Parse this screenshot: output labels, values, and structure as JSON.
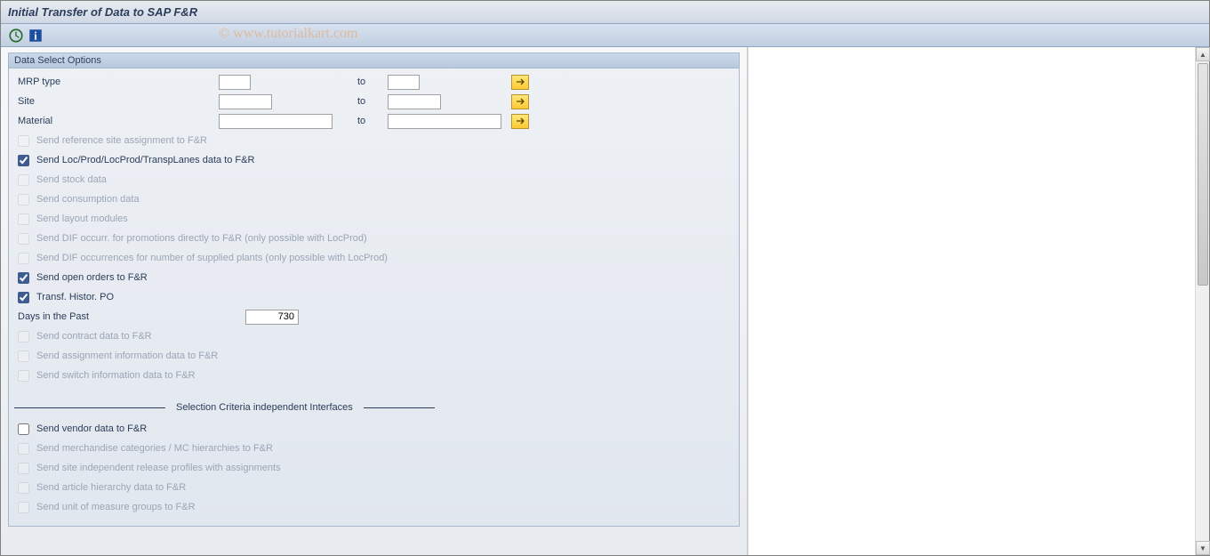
{
  "window": {
    "title": "Initial Transfer of Data to SAP F&R"
  },
  "watermark": "© www.tutorialkart.com",
  "group": {
    "title": "Data Select Options"
  },
  "fields": {
    "mrp_type": {
      "label": "MRP type",
      "from": "",
      "to_label": "to",
      "to": ""
    },
    "site": {
      "label": "Site",
      "from": "",
      "to_label": "to",
      "to": ""
    },
    "material": {
      "label": "Material",
      "from": "",
      "to_label": "to",
      "to": ""
    },
    "days_past": {
      "label": "Days in the Past",
      "value": "730"
    }
  },
  "checkboxes": [
    {
      "id": "chk_ref_site",
      "label": "Send reference site assignment to F&R",
      "checked": false,
      "enabled": false
    },
    {
      "id": "chk_locprod",
      "label": "Send Loc/Prod/LocProd/TranspLanes data to F&R",
      "checked": true,
      "enabled": true
    },
    {
      "id": "chk_stock",
      "label": "Send stock data",
      "checked": false,
      "enabled": false
    },
    {
      "id": "chk_consump",
      "label": "Send consumption data",
      "checked": false,
      "enabled": false
    },
    {
      "id": "chk_layout",
      "label": "Send layout modules",
      "checked": false,
      "enabled": false
    },
    {
      "id": "chk_dif_promo",
      "label": "Send DIF occurr. for promotions directly to F&R (only possible with LocProd)",
      "checked": false,
      "enabled": false
    },
    {
      "id": "chk_dif_supply",
      "label": "Send DIF occurrences for number of supplied plants (only possible with LocProd)",
      "checked": false,
      "enabled": false
    },
    {
      "id": "chk_openord",
      "label": "Send open orders to F&R",
      "checked": true,
      "enabled": true
    },
    {
      "id": "chk_histpo",
      "label": "Transf. Histor. PO",
      "checked": true,
      "enabled": true
    }
  ],
  "checkboxes2": [
    {
      "id": "chk_contract",
      "label": "Send contract data to F&R",
      "checked": false,
      "enabled": false
    },
    {
      "id": "chk_assign",
      "label": "Send assignment information data to F&R",
      "checked": false,
      "enabled": false
    },
    {
      "id": "chk_switch",
      "label": "Send switch information data to F&R",
      "checked": false,
      "enabled": false
    }
  ],
  "section2_title": "Selection Criteria independent Interfaces",
  "checkboxes3": [
    {
      "id": "chk_vendor",
      "label": "Send vendor data to F&R",
      "checked": false,
      "enabled": true
    },
    {
      "id": "chk_merch",
      "label": "Send merchandise categories / MC hierarchies to F&R",
      "checked": false,
      "enabled": false
    },
    {
      "id": "chk_siterel",
      "label": "Send site independent release profiles with assignments",
      "checked": false,
      "enabled": false
    },
    {
      "id": "chk_arthier",
      "label": "Send article hierarchy data to F&R",
      "checked": false,
      "enabled": false
    },
    {
      "id": "chk_uom",
      "label": "Send unit of measure groups to F&R",
      "checked": false,
      "enabled": false
    }
  ]
}
